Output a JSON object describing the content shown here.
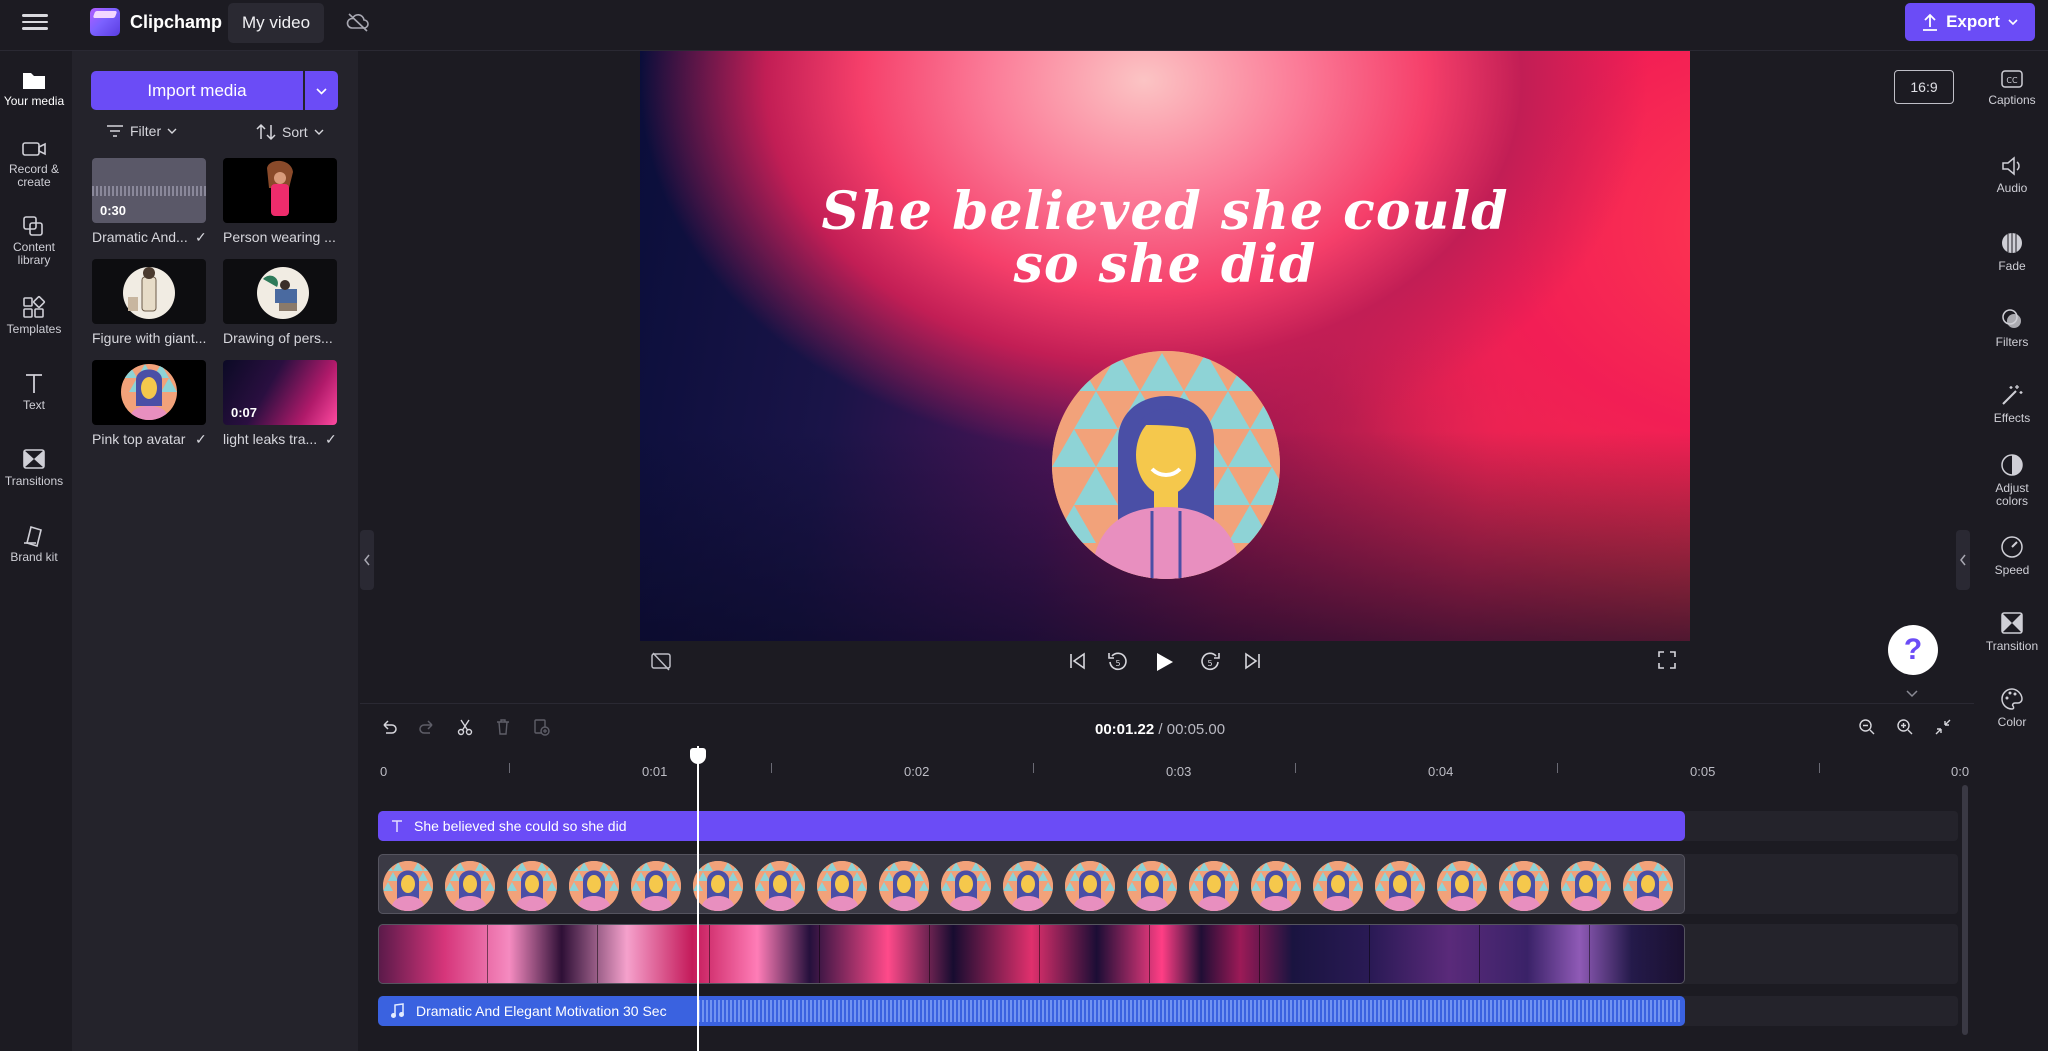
{
  "header": {
    "brand": "Clipchamp",
    "project_name": "My video",
    "export_label": "Export"
  },
  "leftnav": {
    "items": [
      {
        "label": "Your media",
        "icon": "folder-icon"
      },
      {
        "label": "Record &",
        "label2": "create",
        "icon": "camera-icon"
      },
      {
        "label": "Content",
        "label2": "library",
        "icon": "library-icon"
      },
      {
        "label": "Templates",
        "icon": "templates-icon"
      },
      {
        "label": "Text",
        "icon": "text-icon"
      },
      {
        "label": "Transitions",
        "icon": "transitions-icon"
      },
      {
        "label": "Brand kit",
        "icon": "brand-kit-icon"
      }
    ]
  },
  "media": {
    "import_label": "Import media",
    "filter_label": "Filter",
    "sort_label": "Sort",
    "items": [
      {
        "label": "Dramatic And...",
        "duration": "0:30"
      },
      {
        "label": "Person wearing ..."
      },
      {
        "label": "Figure with giant..."
      },
      {
        "label": "Drawing of pers..."
      },
      {
        "label": "Pink top avatar"
      },
      {
        "label": "light leaks tra...",
        "duration": "0:07"
      }
    ]
  },
  "preview": {
    "caption_line1": "She believed she could",
    "caption_line2": "so she did",
    "aspect_ratio": "16:9"
  },
  "help_label": "?",
  "rightnav": {
    "items": [
      {
        "label": "Captions",
        "icon": "captions-icon"
      },
      {
        "label": "Audio",
        "icon": "speaker-icon"
      },
      {
        "label": "Fade",
        "icon": "fade-icon"
      },
      {
        "label": "Filters",
        "icon": "filters-icon"
      },
      {
        "label": "Effects",
        "icon": "magic-wand-icon"
      },
      {
        "label": "Adjust",
        "label2": "colors",
        "icon": "adjust-colors-icon"
      },
      {
        "label": "Speed",
        "icon": "speedometer-icon"
      },
      {
        "label": "Transition",
        "icon": "transition-icon"
      },
      {
        "label": "Color",
        "icon": "palette-icon"
      }
    ]
  },
  "timeline": {
    "current_time": "00:01.22",
    "total_time": " / 00:05.00",
    "ruler": [
      "0",
      "0:01",
      "0:02",
      "0:03",
      "0:04",
      "0:05",
      "0:0"
    ],
    "text_clip": "She believed she could so she did",
    "audio_clip": "Dramatic And Elegant Motivation 30 Sec"
  }
}
